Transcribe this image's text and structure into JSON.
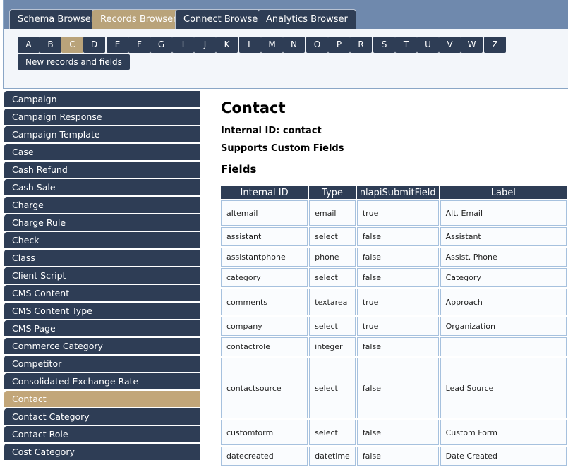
{
  "tabs": [
    {
      "label": "Schema Browser",
      "active": false
    },
    {
      "label": "Records Browser",
      "active": true
    },
    {
      "label": "Connect Browser",
      "active": false
    },
    {
      "label": "Analytics Browser",
      "active": false
    }
  ],
  "letters": [
    "A",
    "B",
    "C",
    "D",
    "E",
    "F",
    "G",
    "I",
    "J",
    "K",
    "L",
    "M",
    "N",
    "O",
    "P",
    "R",
    "S",
    "T",
    "U",
    "V",
    "W",
    "Z"
  ],
  "active_letter": "C",
  "new_records_label": "New records and fields",
  "sidebar": {
    "items": [
      "Campaign",
      "Campaign Response",
      "Campaign Template",
      "Case",
      "Cash Refund",
      "Cash Sale",
      "Charge",
      "Charge Rule",
      "Check",
      "Class",
      "Client Script",
      "CMS Content",
      "CMS Content Type",
      "CMS Page",
      "Commerce Category",
      "Competitor",
      "Consolidated Exchange Rate",
      "Contact",
      "Contact Category",
      "Contact Role",
      "Cost Category"
    ],
    "active": "Contact"
  },
  "main": {
    "title": "Contact",
    "internal_id": "Internal ID: contact",
    "supports": "Supports Custom Fields",
    "fields_heading": "Fields"
  },
  "table": {
    "headers": [
      "Internal ID",
      "Type",
      "nlapiSubmitField",
      "Label"
    ],
    "rows": [
      [
        "altemail",
        "email",
        "true",
        "Alt. Email"
      ],
      [
        "assistant",
        "select",
        "false",
        "Assistant"
      ],
      [
        "assistantphone",
        "phone",
        "false",
        "Assist. Phone"
      ],
      [
        "category",
        "select",
        "false",
        "Category"
      ],
      [
        "comments",
        "textarea",
        "true",
        "Approach"
      ],
      [
        "company",
        "select",
        "true",
        "Organization"
      ],
      [
        "contactrole",
        "integer",
        "false",
        ""
      ],
      [
        "contactsource",
        "select",
        "false",
        "Lead Source"
      ],
      [
        "customform",
        "select",
        "false",
        "Custom Form"
      ],
      [
        "datecreated",
        "datetime",
        "false",
        "Date Created"
      ]
    ]
  },
  "colors": {
    "dark_navy": "#2e3d55",
    "accent_gold": "#b9a37a",
    "tabbar_blue": "#6f89ad",
    "cell_border": "#a6c1de"
  }
}
